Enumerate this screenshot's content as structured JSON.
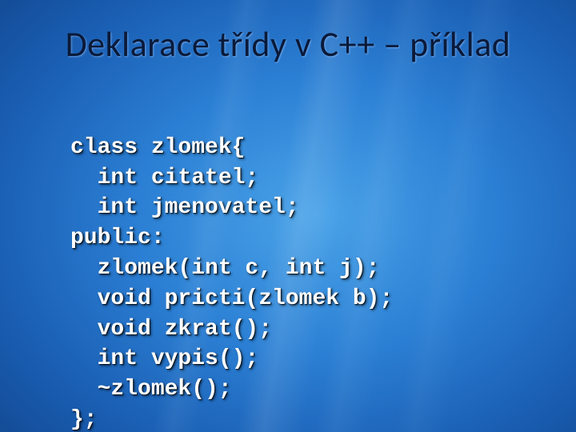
{
  "title": "Deklarace třídy v C++ –  příklad",
  "code_lines": [
    "class zlomek{",
    "  int citatel;",
    "  int jmenovatel;",
    "public:",
    "  zlomek(int c, int j);",
    "  void pricti(zlomek b);",
    "  void zkrat();",
    "  int vypis();",
    "  ~zlomek();",
    "};"
  ]
}
